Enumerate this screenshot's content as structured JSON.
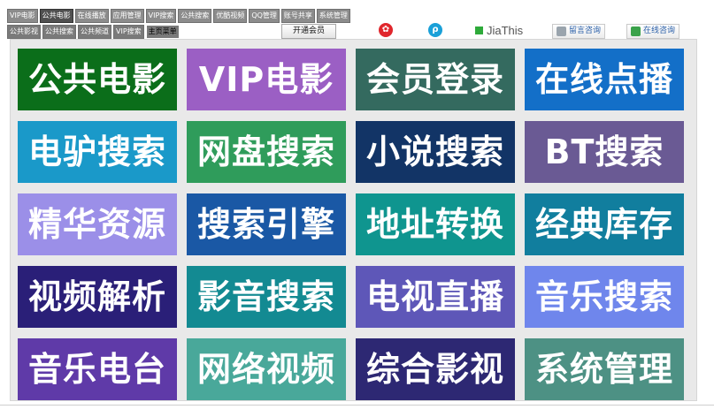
{
  "nav_row1": [
    {
      "label": "VIP电影",
      "active": false
    },
    {
      "label": "公共电影",
      "active": true
    },
    {
      "label": "在线播放",
      "active": false
    },
    {
      "label": "应用管理",
      "active": false
    },
    {
      "label": "VIP搜索",
      "active": false
    },
    {
      "label": "公共搜索",
      "active": false
    },
    {
      "label": "优酷视频",
      "active": false
    },
    {
      "label": "QQ管理",
      "active": false
    },
    {
      "label": "账号共享",
      "active": false
    },
    {
      "label": "系统管理",
      "active": false
    }
  ],
  "nav_row2": [
    {
      "label": "公共影视"
    },
    {
      "label": "公共搜索"
    },
    {
      "label": "公共频道"
    },
    {
      "label": "VIP搜索"
    },
    {
      "label": "主页菜单"
    }
  ],
  "open_member_label": "开通会员",
  "share": {
    "weibo_icon": "weibo-icon",
    "second_icon": "share-circle-icon",
    "jiathis_label": "JiaThis"
  },
  "consult": {
    "message_label": "留言咨询",
    "online_label": "在线咨询"
  },
  "tiles": [
    {
      "label": "公共电影",
      "color": "#0b6e1a"
    },
    {
      "label": "VIP电影",
      "color": "#9b5fc4"
    },
    {
      "label": "会员登录",
      "color": "#346a5f"
    },
    {
      "label": "在线点播",
      "color": "#136fc8"
    },
    {
      "label": "电驴搜索",
      "color": "#1a99c9"
    },
    {
      "label": "网盘搜索",
      "color": "#2f9c5b"
    },
    {
      "label": "小说搜索",
      "color": "#123466"
    },
    {
      "label": "BT搜索",
      "color": "#6a5a94"
    },
    {
      "label": "精华资源",
      "color": "#9b8fe8"
    },
    {
      "label": "搜索引擎",
      "color": "#1a58a5"
    },
    {
      "label": "地址转换",
      "color": "#0f958f"
    },
    {
      "label": "经典库存",
      "color": "#117e9e"
    },
    {
      "label": "视频解析",
      "color": "#2a1f78"
    },
    {
      "label": "影音搜索",
      "color": "#138a92"
    },
    {
      "label": "电视直播",
      "color": "#5e57b8"
    },
    {
      "label": "音乐搜索",
      "color": "#6f86ec"
    },
    {
      "label": "音乐电台",
      "color": "#5f3aa8"
    },
    {
      "label": "网络视频",
      "color": "#49a89a"
    },
    {
      "label": "综合影视",
      "color": "#2d2873"
    },
    {
      "label": "系统管理",
      "color": "#4d9184"
    }
  ]
}
